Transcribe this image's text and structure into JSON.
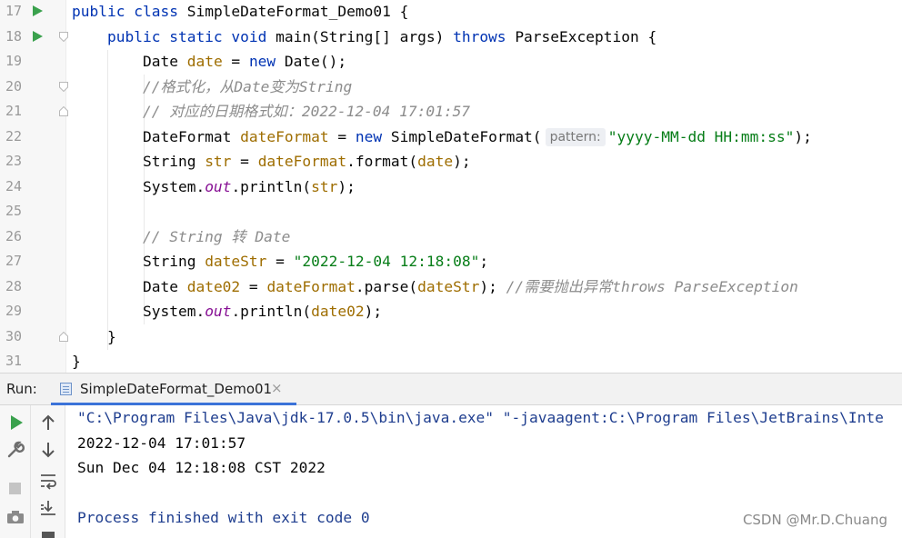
{
  "editor": {
    "lines": [
      {
        "num": "17",
        "run": true,
        "tokens": [
          [
            "public class ",
            "kw"
          ],
          [
            "SimpleDateFormat_Demo01 {",
            ""
          ]
        ]
      },
      {
        "num": "18",
        "run": true,
        "tokens": [
          [
            "    public static void ",
            "kw"
          ],
          [
            "main(String[] args) ",
            ""
          ],
          [
            "throws ",
            "kw"
          ],
          [
            "ParseException {",
            ""
          ]
        ]
      },
      {
        "num": "19",
        "run": false,
        "tokens": [
          [
            "        Date ",
            ""
          ],
          [
            "date",
            "lv"
          ],
          [
            " = ",
            ""
          ],
          [
            "new ",
            "kw"
          ],
          [
            "Date();",
            ""
          ]
        ]
      },
      {
        "num": "20",
        "run": false,
        "tokens": [
          [
            "        //格式化，从Date变为String",
            "cmt"
          ]
        ]
      },
      {
        "num": "21",
        "run": false,
        "tokens": [
          [
            "        // 对应的日期格式如：2022-12-04 17:01:57",
            "cmt"
          ]
        ]
      },
      {
        "num": "22",
        "run": false,
        "tokens": [
          [
            "        DateFormat ",
            ""
          ],
          [
            "dateFormat",
            "lv"
          ],
          [
            " = ",
            ""
          ],
          [
            "new ",
            "kw"
          ],
          [
            "SimpleDateFormat(",
            ""
          ],
          [
            "pattern:",
            "hint"
          ],
          [
            "\"yyyy-MM-dd HH:mm:ss\"",
            "str"
          ],
          [
            ");",
            ""
          ]
        ]
      },
      {
        "num": "23",
        "run": false,
        "tokens": [
          [
            "        String ",
            ""
          ],
          [
            "str",
            "lv"
          ],
          [
            " = ",
            ""
          ],
          [
            "dateFormat",
            "lv"
          ],
          [
            ".format(",
            ""
          ],
          [
            "date",
            "lv"
          ],
          [
            ");",
            ""
          ]
        ]
      },
      {
        "num": "24",
        "run": false,
        "tokens": [
          [
            "        System.",
            ""
          ],
          [
            "out",
            "fld"
          ],
          [
            ".println(",
            ""
          ],
          [
            "str",
            "lv"
          ],
          [
            ");",
            ""
          ]
        ]
      },
      {
        "num": "25",
        "run": false,
        "tokens": []
      },
      {
        "num": "26",
        "run": false,
        "tokens": [
          [
            "        // String 转 Date",
            "cmt"
          ]
        ]
      },
      {
        "num": "27",
        "run": false,
        "tokens": [
          [
            "        String ",
            ""
          ],
          [
            "dateStr",
            "lv"
          ],
          [
            " = ",
            ""
          ],
          [
            "\"2022-12-04 12:18:08\"",
            "str"
          ],
          [
            ";",
            ""
          ]
        ]
      },
      {
        "num": "28",
        "run": false,
        "tokens": [
          [
            "        Date ",
            ""
          ],
          [
            "date02",
            "lv"
          ],
          [
            " = ",
            ""
          ],
          [
            "dateFormat",
            "lv"
          ],
          [
            ".parse(",
            ""
          ],
          [
            "dateStr",
            "lv"
          ],
          [
            "); ",
            ""
          ],
          [
            "//需要抛出异常throws ParseException",
            "cmt"
          ]
        ]
      },
      {
        "num": "29",
        "run": false,
        "tokens": [
          [
            "        System.",
            ""
          ],
          [
            "out",
            "fld"
          ],
          [
            ".println(",
            ""
          ],
          [
            "date02",
            "lv"
          ],
          [
            ");",
            ""
          ]
        ]
      },
      {
        "num": "30",
        "run": false,
        "tokens": [
          [
            "    }",
            ""
          ]
        ]
      },
      {
        "num": "31",
        "run": false,
        "tokens": [
          [
            "}",
            ""
          ]
        ]
      }
    ]
  },
  "run_panel": {
    "label": "Run:",
    "tab_label": "SimpleDateFormat_Demo01",
    "tab_close": "×",
    "console_lines": [
      {
        "text": "\"C:\\Program Files\\Java\\jdk-17.0.5\\bin\\java.exe\" \"-javaagent:C:\\Program Files\\JetBrains\\Inte",
        "style": "blue"
      },
      {
        "text": "2022-12-04 17:01:57",
        "style": ""
      },
      {
        "text": "Sun Dec 04 12:18:08 CST 2022",
        "style": ""
      },
      {
        "text": "",
        "style": ""
      },
      {
        "text": "Process finished with exit code 0",
        "style": "blue"
      }
    ],
    "toolbar_left": [
      "run-icon",
      "wrench-icon",
      "stop-icon",
      "camera-icon"
    ],
    "toolbar_right": [
      "arrow-up-icon",
      "arrow-down-icon",
      "soft-wrap-icon",
      "scroll-to-end-icon",
      "print-icon"
    ]
  },
  "watermark": "CSDN @Mr.D.Chuang",
  "colors": {
    "keyword": "#0033b3",
    "string": "#067d17",
    "local_var": "#9e6d00",
    "field": "#871094",
    "comment": "#8c8c8c",
    "run_icon": "#3aa14d",
    "console_blue": "#1f3e8f"
  }
}
